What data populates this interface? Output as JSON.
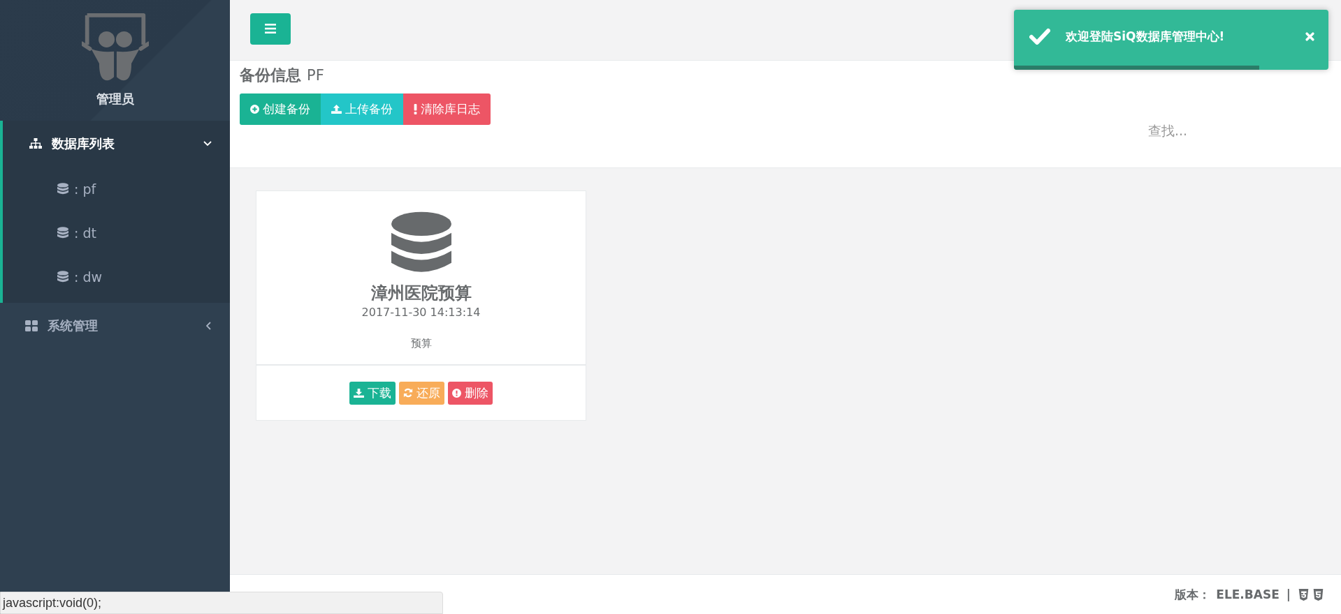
{
  "sidebar": {
    "user": {
      "name": "管理员"
    },
    "groups": [
      {
        "label": "数据库列表",
        "kind": "databases",
        "expanded": true,
        "selected": true,
        "children": [
          {
            "label": ": pf"
          },
          {
            "label": ": dt"
          },
          {
            "label": ": dw"
          }
        ]
      },
      {
        "label": "系统管理",
        "kind": "system",
        "expanded": false,
        "selected": false
      }
    ]
  },
  "toast": {
    "message": "欢迎登陆SiQ数据库管理中心!",
    "progress": {
      "level": 0.78
    }
  },
  "panel": {
    "title": "备份信息",
    "subtitle": "PF",
    "actions": [
      {
        "label": "创建备份",
        "kind": "create"
      },
      {
        "label": "上传备份",
        "kind": "upload"
      },
      {
        "label": "清除库日志",
        "kind": "clear"
      }
    ],
    "search": {
      "placeholder": "查找..."
    }
  },
  "backups": [
    {
      "name": "漳州医院预算",
      "time": "2017-11-30 14:13:14",
      "note": "预算",
      "actions": [
        {
          "label": "下载",
          "kind": "download"
        },
        {
          "label": "还原",
          "kind": "restore"
        },
        {
          "label": "删除",
          "kind": "delete"
        }
      ]
    }
  ],
  "footer": {
    "version_label": "版本：",
    "version": "ELE.BASE",
    "separator": "|"
  },
  "status_bar": {
    "url": "javascript:void(0);"
  }
}
